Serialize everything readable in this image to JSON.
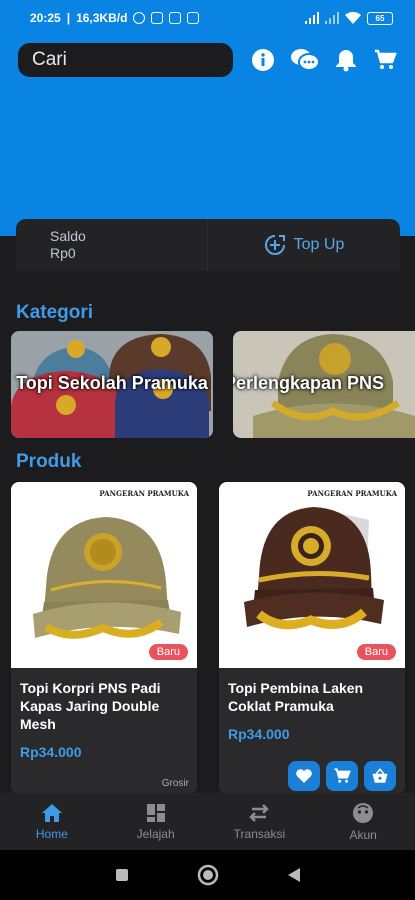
{
  "status_bar": {
    "time": "20:25",
    "network_speed": "16,3KB/d",
    "battery": "65"
  },
  "header": {
    "search_placeholder": "Cari",
    "icons": [
      "info-icon",
      "chat-icon",
      "bell-icon",
      "cart-icon"
    ]
  },
  "saldo": {
    "label": "Saldo",
    "amount": "Rp0",
    "topup_label": "Top Up"
  },
  "kategori": {
    "title": "Kategori",
    "items": [
      {
        "label": "Topi Sekolah Pramuka"
      },
      {
        "label": "Perlengkapan PNS"
      }
    ]
  },
  "produk": {
    "title": "Produk",
    "items": [
      {
        "brand": "PANGERAN PRAMUKA",
        "badge": "Baru",
        "name": "Topi Korpri PNS Padi Kapas Jaring Double Mesh",
        "price": "Rp34.000",
        "tag": "Grosir"
      },
      {
        "brand": "PANGERAN PRAMUKA",
        "badge": "Baru",
        "name": "Topi Pembina Laken Coklat Pramuka",
        "price": "Rp34.000"
      }
    ]
  },
  "bottom_nav": [
    {
      "label": "Home",
      "icon": "home-icon",
      "active": true
    },
    {
      "label": "Jelajah",
      "icon": "grid-icon"
    },
    {
      "label": "Transaksi",
      "icon": "swap-icon"
    },
    {
      "label": "Akun",
      "icon": "face-icon"
    }
  ],
  "colors": {
    "primary": "#0a84e3",
    "accent": "#3f9be6",
    "background": "#1c1c1e",
    "badge": "#e8545e"
  }
}
